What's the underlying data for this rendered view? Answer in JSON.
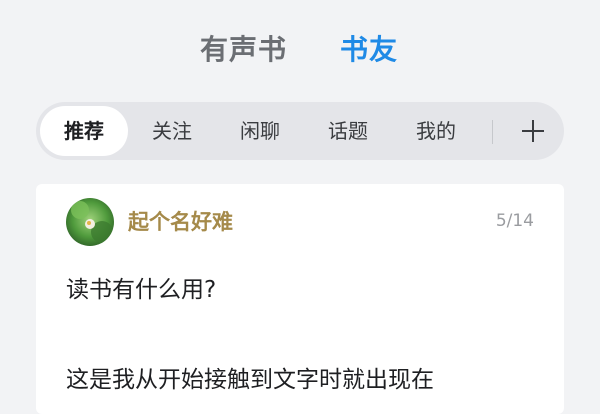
{
  "top_tabs": [
    {
      "label": "有声书",
      "active": false
    },
    {
      "label": "书友",
      "active": true
    }
  ],
  "sub_tabs": [
    {
      "label": "推荐",
      "selected": true
    },
    {
      "label": "关注",
      "selected": false
    },
    {
      "label": "闲聊",
      "selected": false
    },
    {
      "label": "话题",
      "selected": false
    },
    {
      "label": "我的",
      "selected": false
    }
  ],
  "post": {
    "username": "起个名好难",
    "date": "5/14",
    "title": "读书有什么用?",
    "body": "这是我从开始接触到文字时就出现在"
  },
  "icons": {
    "add": "plus-icon",
    "avatar": "avatar-image"
  },
  "colors": {
    "accent": "#1f8ae6",
    "username": "#a58a4a",
    "background": "#f2f3f5"
  }
}
